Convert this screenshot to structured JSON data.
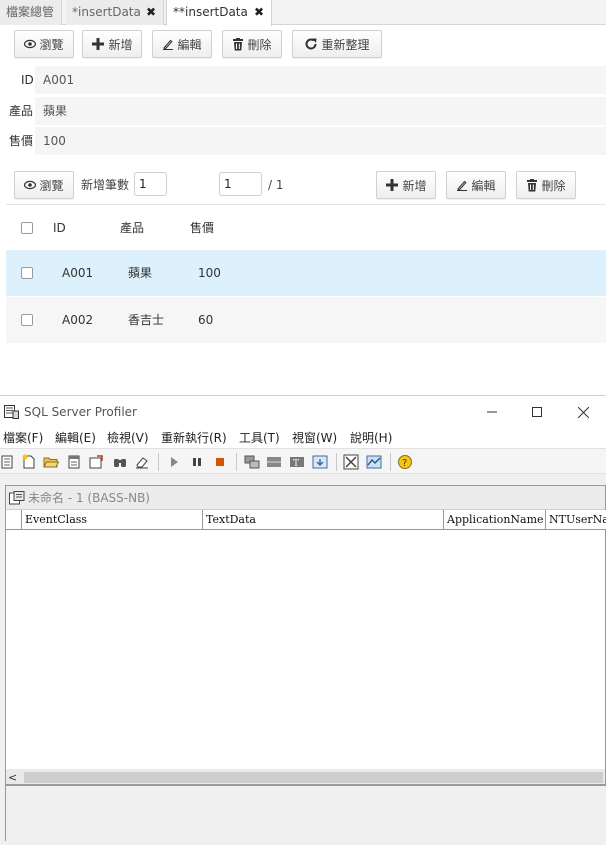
{
  "tabs": [
    {
      "label": "檔案總管"
    },
    {
      "label": "*insertData",
      "close": "✖"
    },
    {
      "label": "**insertData",
      "close": "✖"
    }
  ],
  "toolbar": {
    "browse": "瀏覽",
    "add": "新增",
    "edit": "編輯",
    "delete": "刪除",
    "refresh": "重新整理"
  },
  "form": {
    "id_label": "ID",
    "id_value": "A001",
    "product_label": "產品",
    "product_value": "蘋果",
    "price_label": "售價",
    "price_value": "100"
  },
  "grid_toolbar": {
    "browse": "瀏覽",
    "add_count_label": "新增筆數",
    "add_count_value": "1",
    "page_value": "1",
    "page_total": "/ 1",
    "add": "新增",
    "edit": "編輯",
    "delete": "刪除"
  },
  "grid": {
    "columns": [
      "ID",
      "產品",
      "售價"
    ],
    "rows": [
      {
        "id": "A001",
        "product": "蘋果",
        "price": "100",
        "selected": true
      },
      {
        "id": "A002",
        "product": "香吉士",
        "price": "60",
        "selected": false
      }
    ]
  },
  "profiler": {
    "title": "SQL Server Profiler",
    "menu": [
      "檔案(F)",
      "編輯(E)",
      "檢視(V)",
      "重新執行(R)",
      "工具(T)",
      "視窗(W)",
      "說明(H)"
    ],
    "trace_title": "未命名 - 1 (BASS-NB)",
    "columns": [
      "EventClass",
      "TextData",
      "ApplicationName",
      "NTUserName"
    ],
    "scroll_left": "<"
  },
  "colors": {
    "selected_row": "#dcf1fb",
    "alt_row": "#f6f6f6"
  }
}
